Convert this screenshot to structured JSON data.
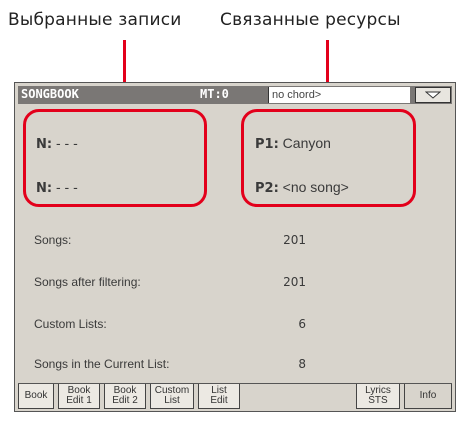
{
  "captions": {
    "selected_records": "Выбранные записи",
    "linked_resources": "Связанные ресурсы"
  },
  "colors": {
    "highlight": "#e3001b",
    "panel": "#d8d4cc",
    "header": "#7a7775"
  },
  "header": {
    "title": "SONGBOOK",
    "mt": "MT:0",
    "chord": "no chord>",
    "menu_icon": "triangle-down-icon"
  },
  "records": {
    "n1_label": "N:",
    "n1_value": "- - -",
    "n2_label": "N:",
    "n2_value": "- - -"
  },
  "resources": {
    "p1_label": "P1:",
    "p1_value": "Canyon",
    "p2_label": "P2:",
    "p2_value": "<no song>"
  },
  "stats": [
    {
      "label": "Songs:",
      "value": "201"
    },
    {
      "label": "Songs after filtering:",
      "value": "201"
    },
    {
      "label": "Custom Lists:",
      "value": "6"
    },
    {
      "label": "Songs in the Current List:",
      "value": "8"
    }
  ],
  "tabs": [
    {
      "label": "Book"
    },
    {
      "label": "Book\nEdit 1"
    },
    {
      "label": "Book\nEdit 2"
    },
    {
      "label": "Custom\nList"
    },
    {
      "label": "List\nEdit"
    },
    {
      "label": "Lyrics\nSTS"
    },
    {
      "label": "Info"
    }
  ]
}
